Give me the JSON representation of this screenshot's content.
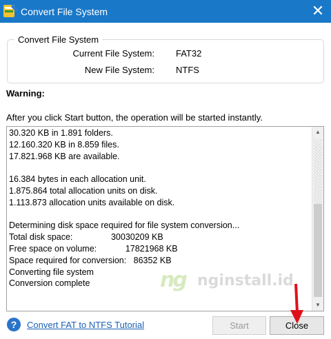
{
  "window": {
    "title": "Convert File System"
  },
  "group": {
    "legend": "Convert File System",
    "current_label": "Current File System:",
    "current_value": "FAT32",
    "new_label": "New File System:",
    "new_value": "NTFS"
  },
  "warning": {
    "title": "Warning:",
    "text": "After you click Start button, the operation will be started instantly."
  },
  "log": {
    "lines": [
      "30.320 KB in 1.891 folders.",
      "12.160.320 KB in 8.859 files.",
      "17.821.968 KB are available.",
      "",
      "16.384 bytes in each allocation unit.",
      "1.875.864 total allocation units on disk.",
      "1.113.873 allocation units available on disk.",
      "",
      "Determining disk space required for file system conversion...",
      "Total disk space:                30030209 KB",
      "Free space on volume:            17821968 KB",
      "Space required for conversion:   86352 KB",
      "Converting file system",
      "Conversion complete"
    ]
  },
  "watermark": {
    "logo": "ng",
    "text": "nginstall.id"
  },
  "footer": {
    "help_link": "Convert FAT to NTFS Tutorial",
    "start_label": "Start",
    "close_label": "Close"
  },
  "colors": {
    "titlebar": "#1a78c8",
    "link": "#1a5fb4",
    "arrow": "#e0101a"
  },
  "icons": {
    "app": "partition-tool-icon",
    "close": "close-icon",
    "help": "help-circle-icon"
  }
}
